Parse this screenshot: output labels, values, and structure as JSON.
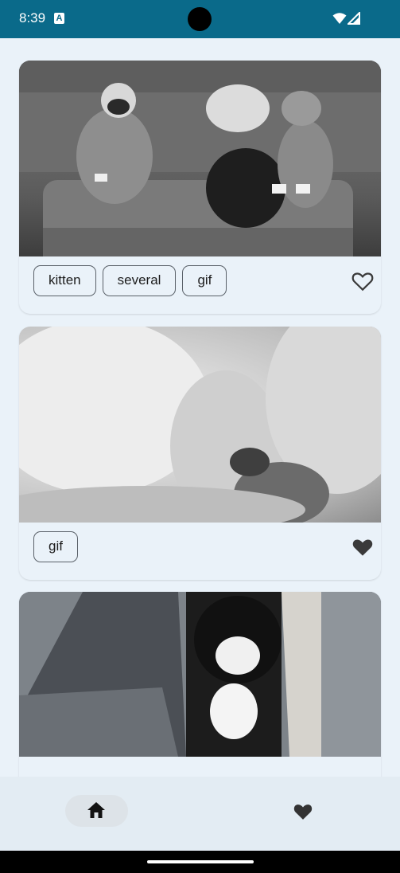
{
  "status_bar": {
    "time": "8:39",
    "notification_icon": "a-notification-icon",
    "wifi_icon": "wifi-icon",
    "signal_icon": "cell-signal-icon",
    "color": "#0a6a8a"
  },
  "feed": {
    "cards": [
      {
        "image": "kittens-on-sofa-photo",
        "tags": [
          "kitten",
          "several",
          "gif"
        ],
        "favorited": false,
        "fav_icon": "heart-outline-icon"
      },
      {
        "image": "blurry-cat-closeup-photo",
        "tags": [
          "gif"
        ],
        "favorited": true,
        "fav_icon": "heart-filled-icon"
      },
      {
        "image": "tuxedo-cat-on-lap-photo",
        "tags": [],
        "favorited": false
      }
    ]
  },
  "bottom_nav": {
    "items": [
      {
        "name": "home",
        "icon": "home-icon",
        "selected": true
      },
      {
        "name": "favorites",
        "icon": "heart-filled-icon",
        "selected": false
      }
    ]
  },
  "colors": {
    "background": "#eaf2f9",
    "accent": "#0a6a8a",
    "icon": "#3a3a3a"
  }
}
